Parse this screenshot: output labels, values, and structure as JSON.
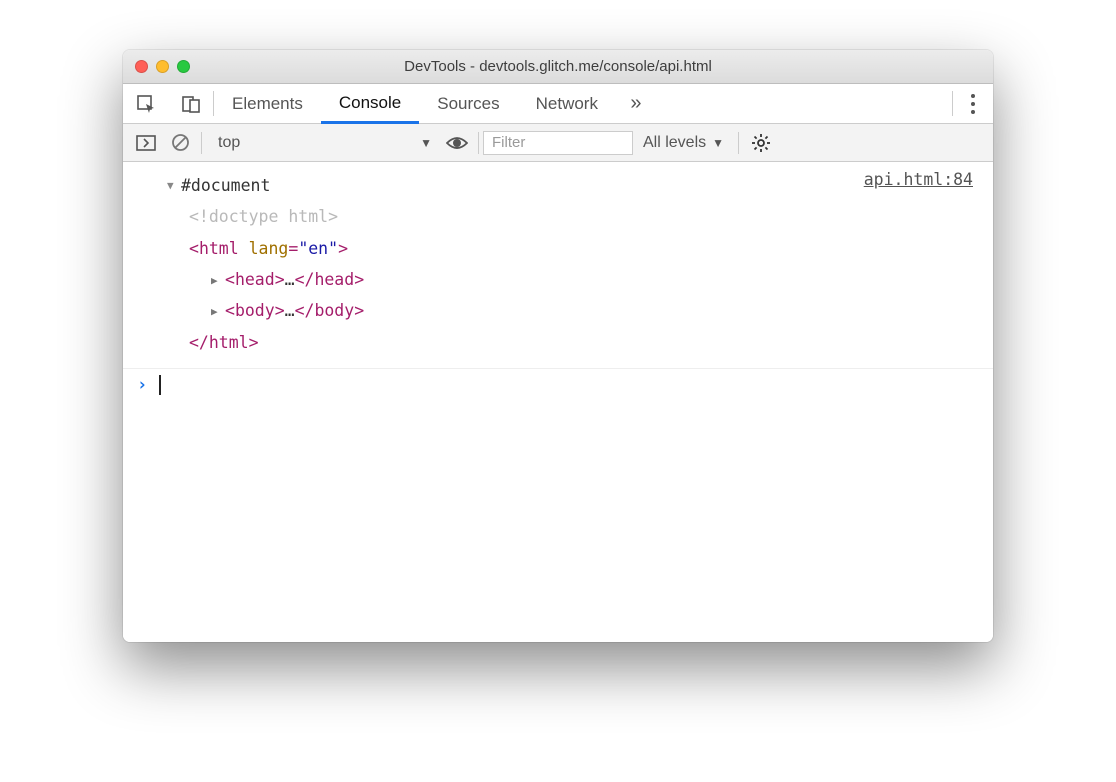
{
  "window": {
    "title": "DevTools - devtools.glitch.me/console/api.html"
  },
  "tabs": {
    "items": [
      "Elements",
      "Console",
      "Sources",
      "Network"
    ],
    "active_index": 1
  },
  "filterbar": {
    "context": "top",
    "filter_placeholder": "Filter",
    "levels_label": "All levels"
  },
  "console": {
    "source_link": "api.html:84",
    "dom": {
      "root_label": "#document",
      "doctype": "<!doctype html>",
      "html_open_tag": "html",
      "html_open_attr": "lang",
      "html_open_attrval": "\"en\"",
      "head_tag": "head",
      "body_tag": "body",
      "ellipsis": "…",
      "html_close": "</html>"
    }
  }
}
